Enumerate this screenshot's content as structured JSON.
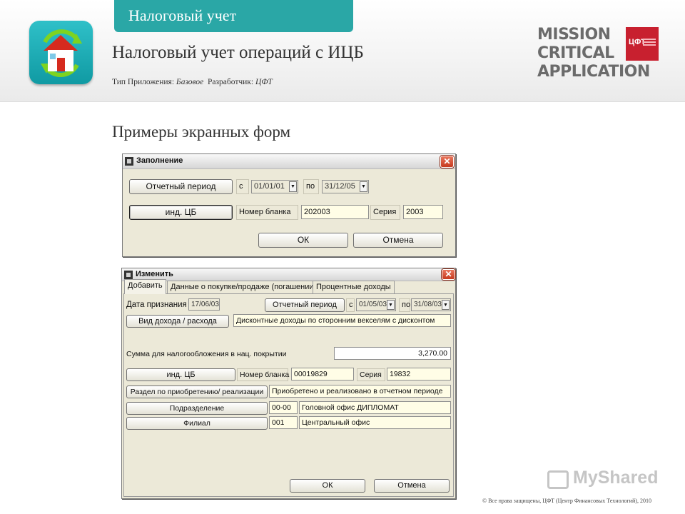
{
  "header": {
    "section_tab": "Налоговый учет",
    "app_title": "Налоговый учет операций с ИЦБ",
    "meta_type_label": "Тип Приложения:",
    "meta_type_value": "Базовое",
    "meta_dev_label": "Разработчик:",
    "meta_dev_value": "ЦФТ",
    "logo_line1": "MISSION",
    "logo_line2": "CRITICAL",
    "logo_line3": "APPLICATION",
    "badge_text": "ЦФТ",
    "icon": "house-refresh-icon"
  },
  "section_title": "Примеры экранных форм",
  "fill_window": {
    "title": "Заполнение",
    "period_button": "Отчетный период",
    "from_label": "с",
    "from_value": "01/01/01",
    "to_label": "по",
    "to_value": "31/12/05",
    "ind_button": "инд. ЦБ",
    "blank_label": "Номер бланка",
    "blank_value": "202003",
    "series_label": "Серия",
    "series_value": "2003",
    "ok": "ОК",
    "cancel": "Отмена"
  },
  "edit_window": {
    "title": "Изменить",
    "tabs": [
      "Добавить",
      "Данные о покупке/продаже (погашении)",
      "Процентные доходы"
    ],
    "recognition_date_label": "Дата признания",
    "recognition_date_value": "17/06/03",
    "period_button": "Отчетный период",
    "from_label": "с",
    "from_value": "01/05/03",
    "to_label": "по",
    "to_value": "31/08/03",
    "income_type_button": "Вид дохода / расхода",
    "income_type_value": "Дисконтные доходы по сторонним векселям с дисконтом",
    "taxable_sum_label": "Сумма для налогообложения в нац. покрытии",
    "taxable_sum_value": "3,270.00",
    "ind_button": "инд. ЦБ",
    "blank_label": "Номер бланка",
    "blank_value": "00019829",
    "series_label": "Серия",
    "series_value": "19832",
    "section_button": "Раздел по приобретению/ реализации",
    "section_value": "Приобретено и реализовано в отчетном периоде",
    "division_button": "Подразделение",
    "division_code": "00-00",
    "division_name": "Головной офис ДИПЛОМАТ",
    "branch_button": "Филиал",
    "branch_code": "001",
    "branch_name": "Центральный офис",
    "ok": "ОК",
    "cancel": "Отмена"
  },
  "footer": {
    "watermark": "MyShared",
    "copyright": "© Все права защищены, ЦФТ (Центр Финансовых Технологий), 2010"
  },
  "colors": {
    "accent_teal": "#2aa7a6",
    "brand_red": "#c8202f",
    "window_bg": "#ece9d8",
    "field_bg": "#fffde6"
  }
}
